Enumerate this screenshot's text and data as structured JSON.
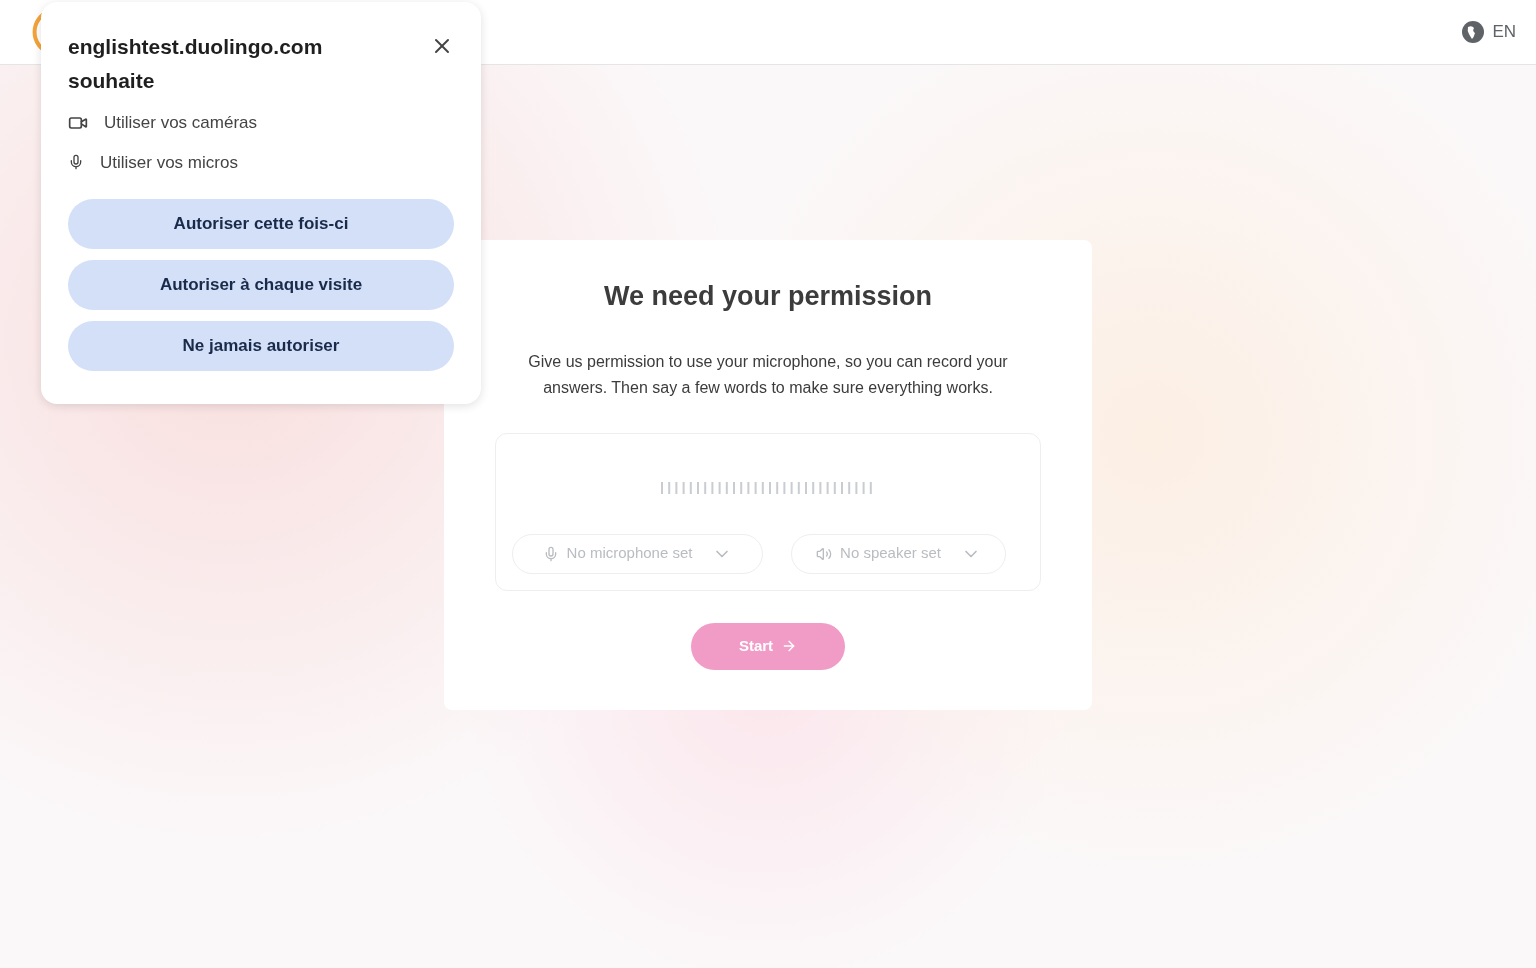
{
  "header": {
    "language": "EN"
  },
  "card": {
    "title": "We need your permission",
    "description": "Give us permission to use your microphone, so you can record your answers. Then say a few words to make sure everything works.",
    "devices": [
      {
        "kind": "microphone",
        "label": "No microphone set",
        "disabled": true
      },
      {
        "kind": "speaker",
        "label": "No speaker set",
        "disabled": true
      }
    ],
    "start_button": {
      "label": "Start",
      "disabled": true
    }
  },
  "permission_popup": {
    "title": "englishtest.duolingo.com souhaite",
    "permissions": [
      {
        "kind": "camera",
        "label": "Utiliser vos caméras"
      },
      {
        "kind": "microphone",
        "label": "Utiliser vos micros"
      }
    ],
    "buttons": [
      "Autoriser cette fois-ci",
      "Autoriser à chaque visite",
      "Ne jamais autoriser"
    ]
  }
}
